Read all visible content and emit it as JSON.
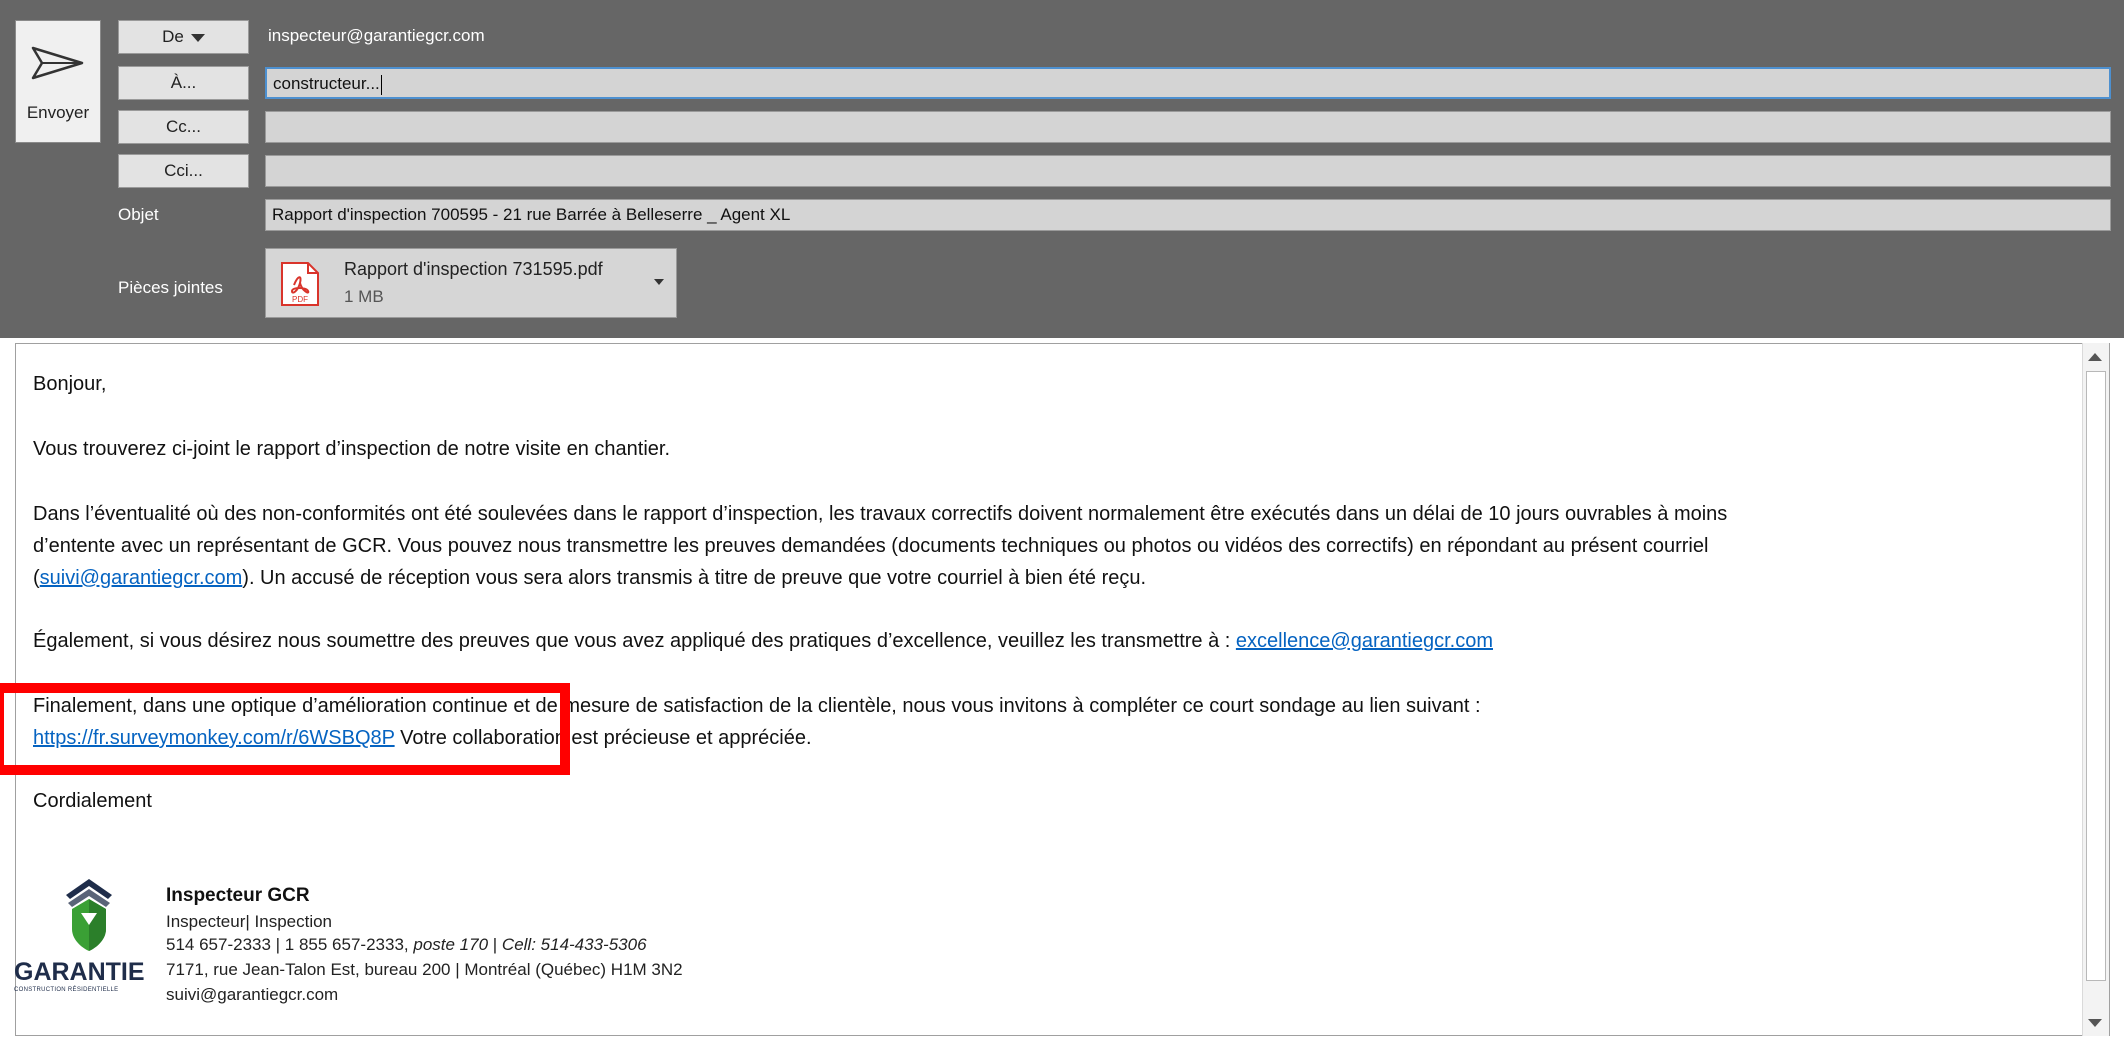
{
  "compose": {
    "send_label": "Envoyer",
    "from_button": "De",
    "from_value": "inspecteur@garantiegcr.com",
    "to_button": "À...",
    "to_value": "constructeur...",
    "cc_button": "Cc...",
    "cc_value": "",
    "bcc_button": "Cci...",
    "bcc_value": "",
    "subject_label": "Objet",
    "subject_value": "Rapport d'inspection 700595 - 21 rue Barrée à Belleserre _ Agent XL",
    "attachments_label": "Pièces jointes",
    "attachment": {
      "name": "Rapport d'inspection 731595.pdf",
      "size": "1 MB",
      "icon_label": "PDF"
    }
  },
  "message": {
    "greeting": "Bonjour,",
    "p1": "Vous trouverez ci-joint le rapport d’inspection de notre visite en chantier.",
    "p2_line1": "Dans l’éventualité où des non-conformités ont été soulevées dans le rapport d’inspection, les travaux correctifs doivent normalement être exécutés dans un délai de 10 jours ouvrables à moins",
    "p2_line2": "d’entente avec un représentant de GCR. Vous pouvez nous transmettre les preuves demandées (documents techniques ou photos ou vidéos des correctifs) en répondant au présent courriel",
    "p2_line3_pre": "(",
    "p2_line3_link": "suivi@garantiegcr.com",
    "p2_line3_post": "). Un accusé de réception vous sera alors transmis à titre de preuve que votre courriel à bien été reçu.",
    "p3_text": "Également, si vous désirez nous soumettre des preuves que vous avez appliqué des pratiques d’excellence, veuillez les transmettre à : ",
    "p3_link": "excellence@garantiegcr.com",
    "p4_line1": "Finalement, dans une optique d’amélioration continue et de mesure de satisfaction de la clientèle, nous vous invitons à compléter ce court sondage au lien suivant :",
    "p4_link": "https://fr.surveymonkey.com/r/6WSBQ8P",
    "p4_post": " Votre collaboration est précieuse et appréciée.",
    "closing": "Cordialement"
  },
  "signature": {
    "name": "Inspecteur GCR",
    "title": "Inspecteur| Inspection",
    "phone_pre": "514 657-2333 | 1 855 657-2333, ",
    "phone_ext": "poste 170",
    "phone_sep": " | ",
    "phone_cell": "Cell: 514-433-5306",
    "address": "7171, rue Jean-Talon Est, bureau 200 | Montréal (Québec) H1M 3N2",
    "email": "suivi@garantiegcr.com",
    "logo_text": "GARANTIE",
    "logo_sub": "CONSTRUCTION RÉSIDENTIELLE"
  },
  "colors": {
    "header_bg": "#666666",
    "link": "#0563c1",
    "highlight": "#ff0000",
    "logo_green": "#3aa035",
    "logo_navy": "#1f2d4a"
  }
}
